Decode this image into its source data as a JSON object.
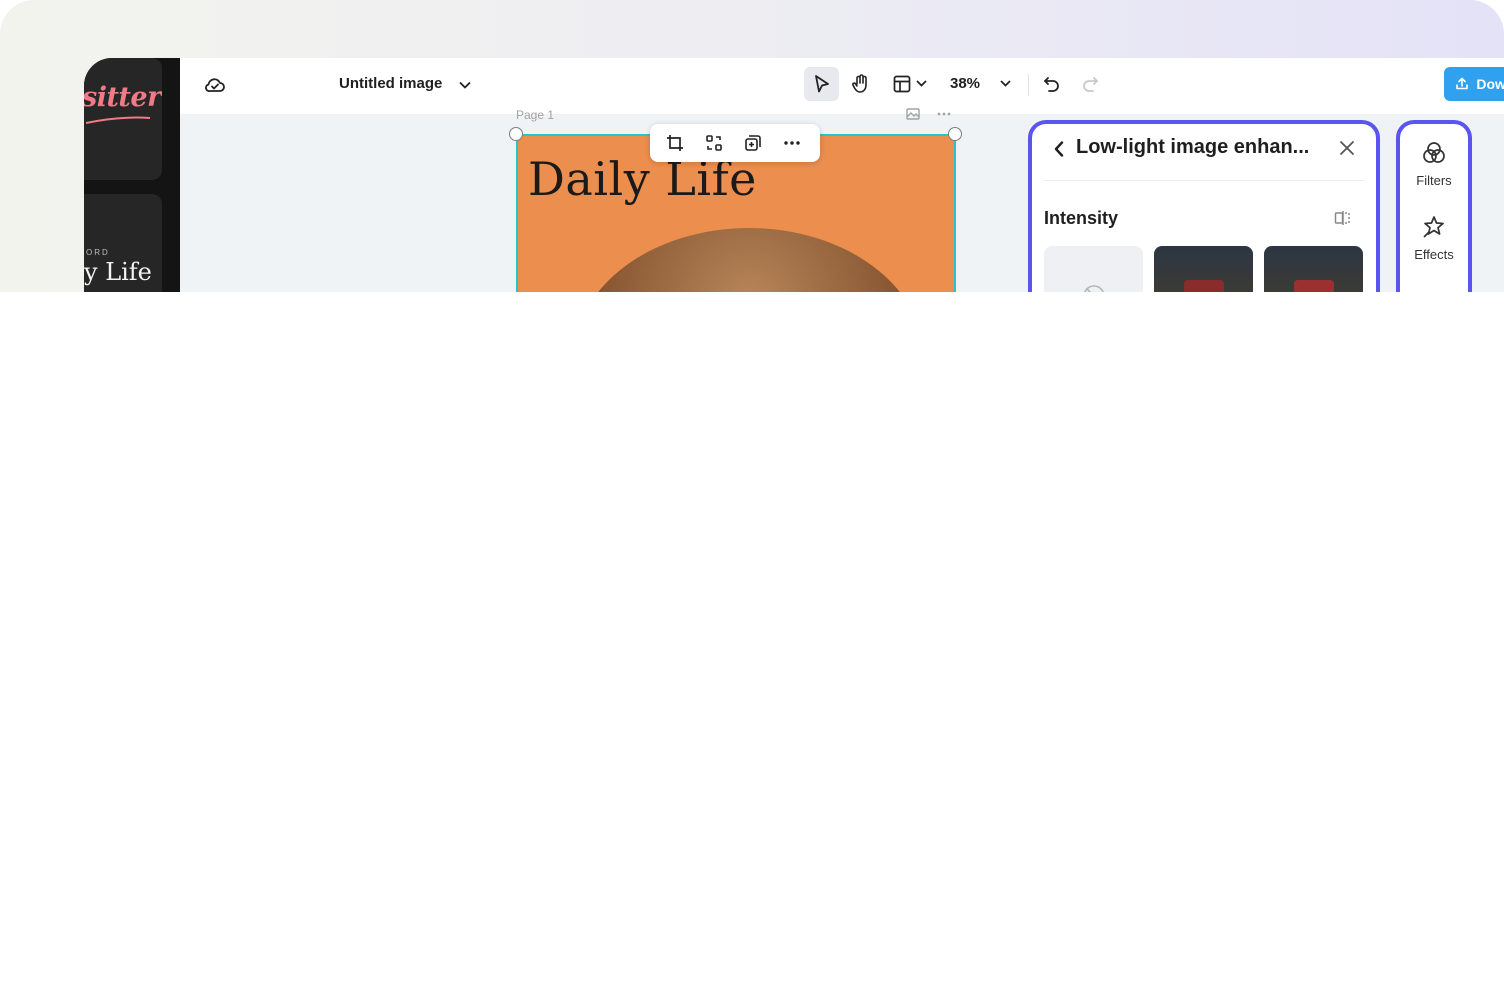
{
  "left_rail": {
    "template1_text": "sitter",
    "template2_small": "ORD",
    "template2_big": "y Life"
  },
  "toolbar": {
    "document_title": "Untitled image",
    "zoom": "38%",
    "download_label": "Download all"
  },
  "canvas": {
    "page_label": "Page 1",
    "art_title": "Daily Life"
  },
  "panel": {
    "title": "Low-light image enhan...",
    "intensity_label": "Intensity"
  },
  "tools": [
    {
      "label": "Filters",
      "icon": "filters-icon"
    },
    {
      "label": "Effects",
      "icon": "effects-icon"
    }
  ],
  "colors": {
    "accent": "#5b55f0",
    "download": "#2fa1ee",
    "selection": "#2bc3c9",
    "artboard_bg": "#eb8e4e"
  }
}
